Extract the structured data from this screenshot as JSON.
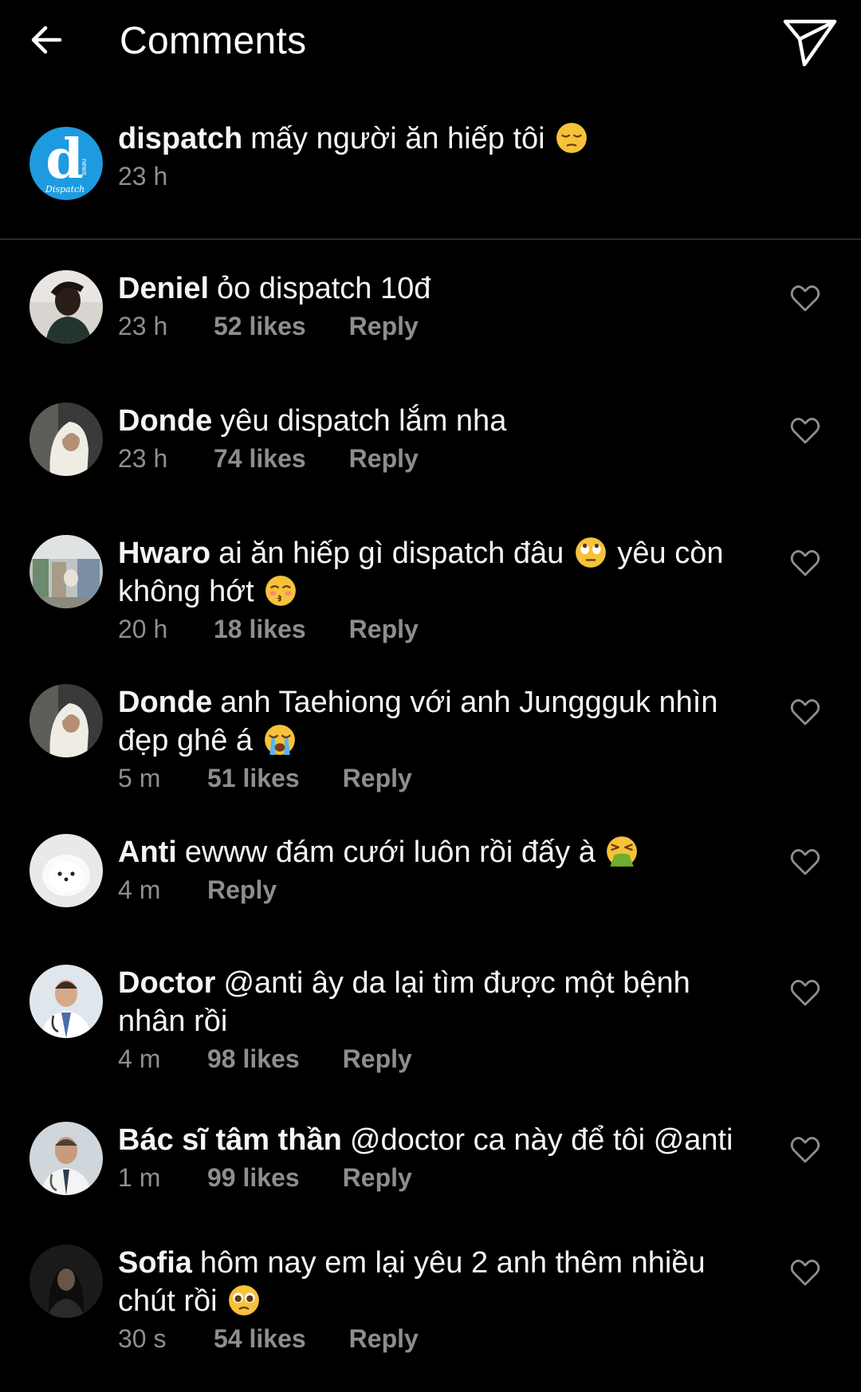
{
  "header": {
    "title": "Comments",
    "back_icon": "arrow-left-icon",
    "send_icon": "paper-plane-icon"
  },
  "caption": {
    "username": "dispatch",
    "text": "mấy người ăn hiếp tôi",
    "emoji": "pensive-face",
    "time": "23 h",
    "avatar_letter": "d",
    "avatar_brand": "Dispatch",
    "avatar_small": "news",
    "avatar_color": "#1e9be0"
  },
  "comments": [
    {
      "username": "Deniel",
      "text": "ỏo dispatch 10đ",
      "time": "23 h",
      "likes": "52 likes",
      "reply": "Reply",
      "avatar": "person-dark-photo"
    },
    {
      "username": "Donde",
      "text": "yêu dispatch lắm nha",
      "time": "23 h",
      "likes": "74 likes",
      "reply": "Reply",
      "avatar": "hooded-person-photo"
    },
    {
      "username": "Hwaro",
      "text_part1": "ai ăn hiếp gì dispatch đâu",
      "emoji1": "eye-roll-face",
      "text_part2": "yêu còn không hớt",
      "emoji2": "kissing-face",
      "time": "20 h",
      "likes": "18 likes",
      "reply": "Reply",
      "avatar": "store-photo"
    },
    {
      "username": "Donde",
      "text": "anh Taehiong với anh Junggguk nhìn đẹp ghê á",
      "emoji": "crying-face",
      "time": "5 m",
      "likes": "51 likes",
      "reply": "Reply",
      "avatar": "hooded-person-photo"
    },
    {
      "username": "Anti",
      "text": "ewww đám cưới luôn rồi đấy à",
      "emoji": "vomiting-face",
      "time": "4 m",
      "reply": "Reply",
      "avatar": "white-dog-photo"
    },
    {
      "username": "Doctor",
      "text": "@anti ây da lại tìm được một bệnh nhân rồi",
      "time": "4 m",
      "likes": "98 likes",
      "reply": "Reply",
      "avatar": "doctor-photo"
    },
    {
      "username": "Bác sĩ tâm thần",
      "text": "@doctor ca này để tôi @anti",
      "time": "1 m",
      "likes": "99 likes",
      "reply": "Reply",
      "avatar": "doctor-photo-2"
    },
    {
      "username": "Sofia",
      "text": "hôm nay em lại yêu 2 anh thêm nhiều chút rồi",
      "emoji": "pleading-face",
      "time": "30 s",
      "likes": "54 likes",
      "reply": "Reply",
      "avatar": "girl-dark-photo"
    }
  ]
}
